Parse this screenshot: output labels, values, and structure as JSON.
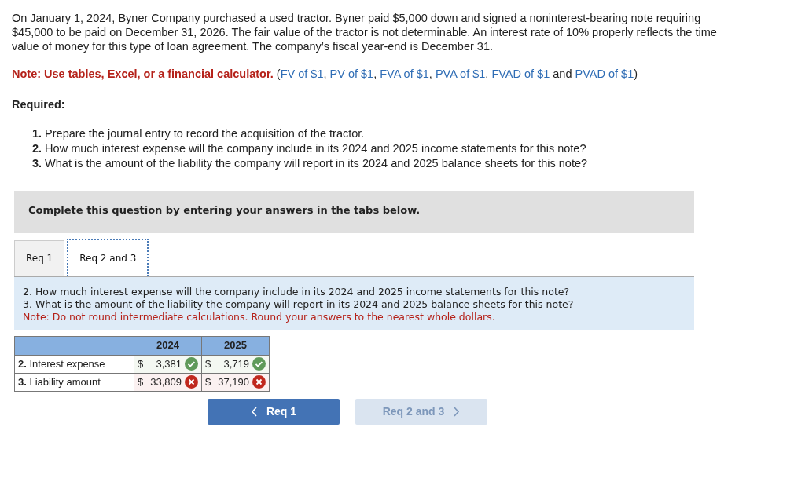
{
  "intro": "On January 1, 2024, Byner Company purchased a used tractor. Byner paid $5,000 down and signed a noninterest-bearing note requiring $45,000 to be paid on December 31, 2026. The fair value of the tractor is not determinable. An interest rate of 10% properly reflects the time value of money for this type of loan agreement. The company’s fiscal year-end is December 31.",
  "note": {
    "prefix": "Note: Use tables, Excel, or a financial calculator.",
    "parts": [
      {
        "kind": "text",
        "text": " ("
      },
      {
        "kind": "link",
        "text": "FV of $1"
      },
      {
        "kind": "text",
        "text": ", "
      },
      {
        "kind": "link",
        "text": "PV of $1"
      },
      {
        "kind": "text",
        "text": ", "
      },
      {
        "kind": "link",
        "text": "FVA of $1"
      },
      {
        "kind": "text",
        "text": ", "
      },
      {
        "kind": "link",
        "text": "PVA of $1"
      },
      {
        "kind": "text",
        "text": ", "
      },
      {
        "kind": "link",
        "text": "FVAD of $1"
      },
      {
        "kind": "text",
        "text": " and "
      },
      {
        "kind": "link",
        "text": "PVAD of $1"
      },
      {
        "kind": "text",
        "text": ")"
      }
    ]
  },
  "required_heading": "Required:",
  "requirements": [
    "**1.** Prepare the journal entry to record the acquisition of the tractor.",
    "**2.** How much interest expense will the company include in its 2024 and 2025 income statements for this note?",
    "**3.** What is the amount of the liability the company will report in its 2024 and 2025 balance sheets for this note?"
  ],
  "banner": "Complete this question by entering your answers in the tabs below.",
  "tabs": [
    {
      "label": "Req 1",
      "selected": false
    },
    {
      "label": "Req 2 and 3",
      "selected": true
    }
  ],
  "question": {
    "lines": [
      "2. How much interest expense will the company include in its 2024 and 2025 income statements for this note?",
      "3. What is the amount of the liability the company will report in its 2024 and 2025 balance sheets for this note?"
    ],
    "note": "Note: Do not round intermediate calculations. Round your answers to the nearest whole dollars."
  },
  "table": {
    "columns": [
      "2024",
      "2025"
    ],
    "rows": [
      {
        "label": "**2.** Interest expense",
        "cells": [
          {
            "currency": "$",
            "value": "3,381",
            "correct": true
          },
          {
            "currency": "$",
            "value": "3,719",
            "correct": true
          }
        ]
      },
      {
        "label": "**3.** Liability amount",
        "cells": [
          {
            "currency": "$",
            "value": "33,809",
            "correct": false
          },
          {
            "currency": "$",
            "value": "37,190",
            "correct": false
          }
        ]
      }
    ]
  },
  "buttons": [
    {
      "label": "Req 1",
      "kind": "prev",
      "disabled": false
    },
    {
      "label": "Req 2 and 3",
      "kind": "next",
      "disabled": true
    }
  ]
}
